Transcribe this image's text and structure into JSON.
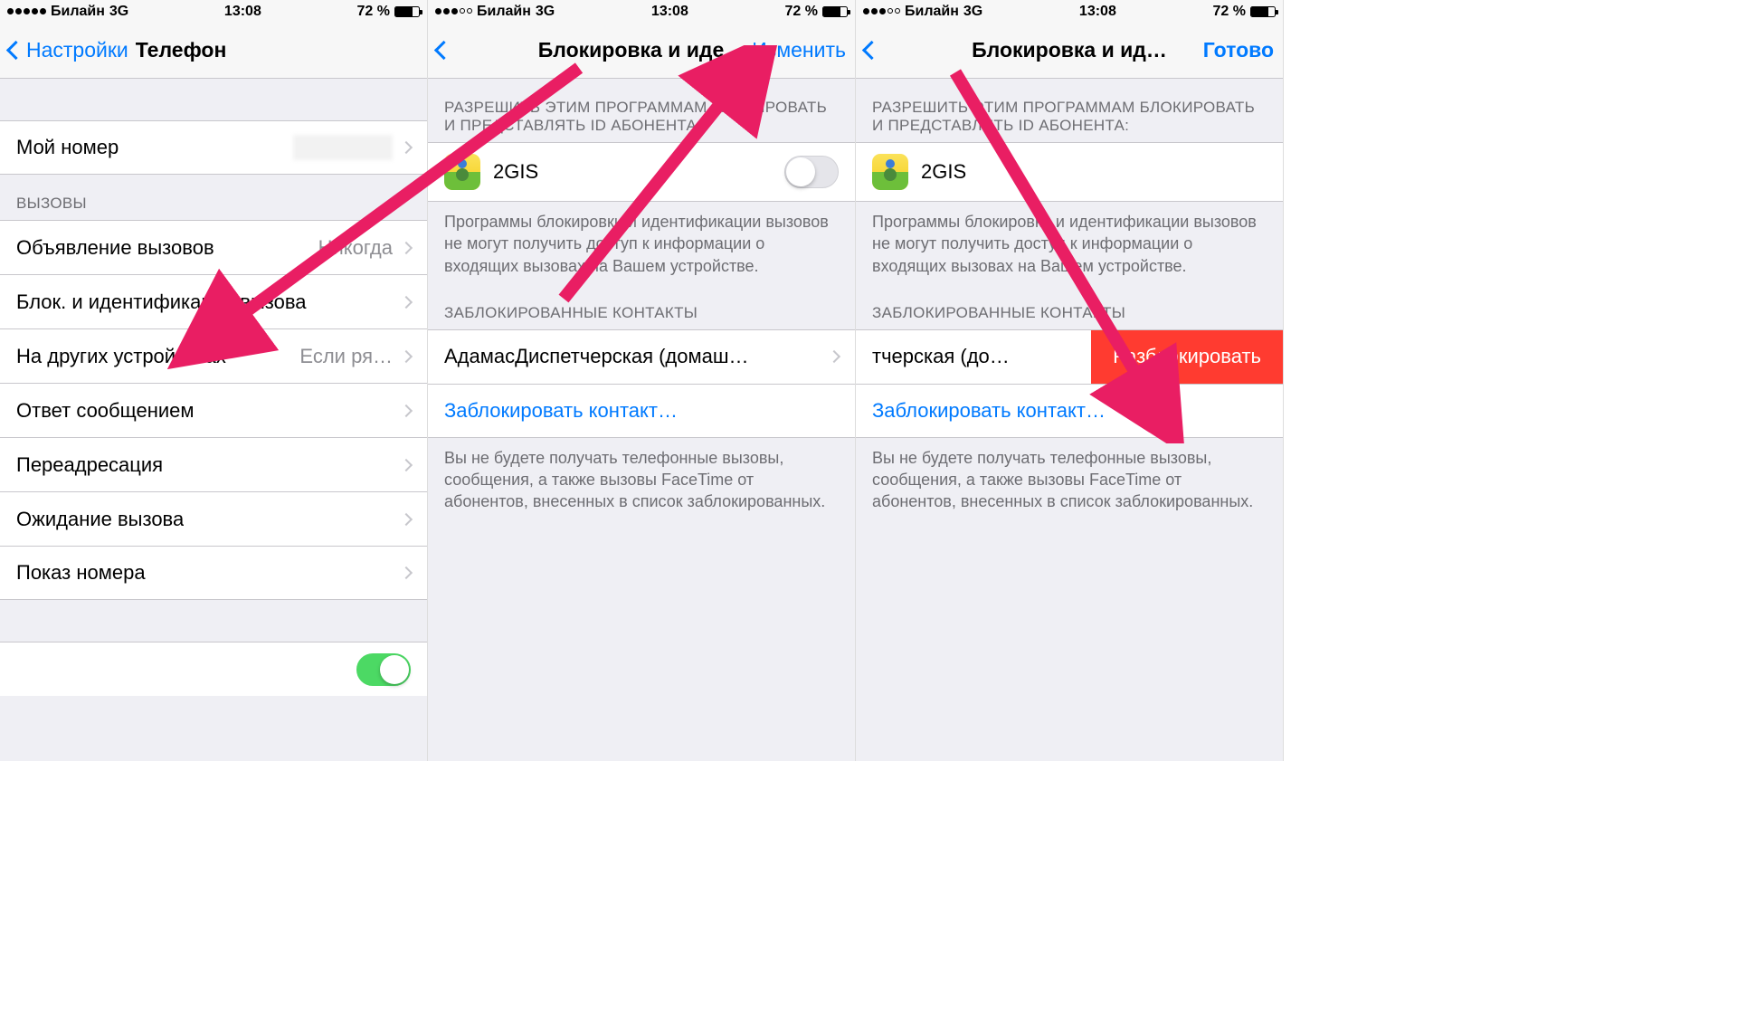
{
  "status": {
    "carrier": "Билайн",
    "net": "3G",
    "time": "13:08",
    "battery_pct": "72 %",
    "signal1": 5,
    "signal2": 3,
    "signal3": 3
  },
  "screen1": {
    "back_label": "Настройки",
    "title": "Телефон",
    "my_number": "Мой номер",
    "sec_calls": "ВЫЗОВЫ",
    "row_announce": "Объявление вызовов",
    "row_announce_val": "Никогда",
    "row_block": "Блок. и идентификация вызова",
    "row_other": "На других устройствах",
    "row_other_val": "Если ря…",
    "row_reply": "Ответ сообщением",
    "row_forward": "Переадресация",
    "row_wait": "Ожидание вызова",
    "row_show": "Показ номера"
  },
  "screen2": {
    "title": "Блокировка и иде…",
    "action": "Изменить",
    "sec_allow": "РАЗРЕШИТЬ ЭТИМ ПРОГРАММАМ БЛОКИРОВАТЬ И ПРЕДСТАВЛЯТЬ ID АБОНЕНТА:",
    "app_name": "2GIS",
    "allow_foot": "Программы блокировки и идентификации вызовов не могут получить доступ к информации о входящих вызовах на Вашем устройстве.",
    "sec_blocked": "ЗАБЛОКИРОВАННЫЕ КОНТАКТЫ",
    "blocked_name": "АдамасДиспетчерская (домаш…",
    "add_block": "Заблокировать контакт…",
    "blocked_foot": "Вы не будете получать телефонные вызовы, сообщения, а также вызовы FaceTime от абонентов, внесенных в список заблокированных."
  },
  "screen3": {
    "title": "Блокировка и ид…",
    "action": "Готово",
    "sec_allow": "РАЗРЕШИТЬ ЭТИМ ПРОГРАММАМ БЛОКИРОВАТЬ И ПРЕДСТАВЛЯТЬ ID АБОНЕНТА:",
    "app_name": "2GIS",
    "allow_foot": "Программы блокировки и идентификации вызовов не могут получить доступ к информации о входящих вызовах на Вашем устройстве.",
    "sec_blocked": "ЗАБЛОКИРОВАННЫЕ КОНТАКТЫ",
    "blocked_name": "тчерская (до…",
    "unblock": "Разблокировать",
    "add_block": "Заблокировать контакт…",
    "blocked_foot": "Вы не будете получать телефонные вызовы, сообщения, а также вызовы FaceTime от абонентов, внесенных в список заблокированных."
  }
}
